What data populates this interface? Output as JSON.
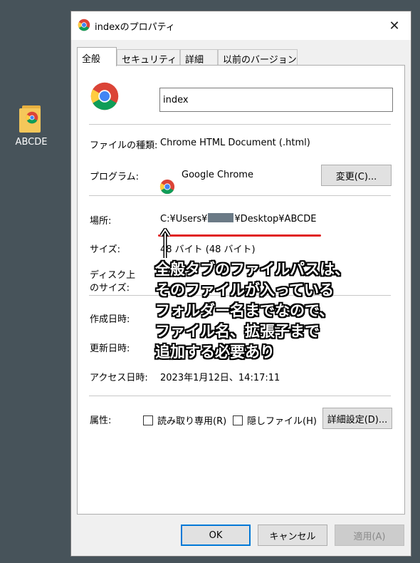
{
  "desktop": {
    "icon_label": "ABCDE",
    "icon_name": "folder-icon"
  },
  "dialog": {
    "title": "indexのプロパティ",
    "close_label": "✕",
    "tabs": [
      {
        "label": "全般",
        "active": true
      },
      {
        "label": "セキュリティ",
        "active": false
      },
      {
        "label": "詳細",
        "active": false
      },
      {
        "label": "以前のバージョン",
        "active": false
      }
    ],
    "name_value": "index",
    "rows": {
      "file_type": {
        "label": "ファイルの種類:",
        "value": "Chrome HTML Document (.html)"
      },
      "program": {
        "label": "プログラム:",
        "value": "Google Chrome",
        "button": "変更(C)..."
      },
      "location": {
        "label": "場所:",
        "value_prefix": "C:¥Users¥",
        "value_suffix": "¥Desktop¥ABCDE"
      },
      "size": {
        "label": "サイズ:",
        "value": "48 バイト (48 バイト)"
      },
      "size_on_disk": {
        "label_line1": "ディスク上",
        "label_line2": "のサイズ:"
      },
      "created": {
        "label": "作成日時:"
      },
      "modified": {
        "label": "更新日時:"
      },
      "accessed": {
        "label": "アクセス日時:",
        "value": "2023年1月12日、14:17:11"
      },
      "attributes": {
        "label": "属性:",
        "readonly": "読み取り専用(R)",
        "hidden": "隠しファイル(H)",
        "advanced_button": "詳細設定(D)..."
      }
    },
    "footer": {
      "ok": "OK",
      "cancel": "キャンセル",
      "apply": "適用(A)"
    }
  },
  "annotation": {
    "arrow": "↑",
    "text": "全般タブのファイルパスは、\nそのファイルが入っている\nフォルダー名までなので、\nファイル名、拡張子まで\n追加する必要あり"
  },
  "colors": {
    "desktop_bg": "#47535a",
    "underline_red": "#e02020",
    "accent": "#0078d7"
  }
}
